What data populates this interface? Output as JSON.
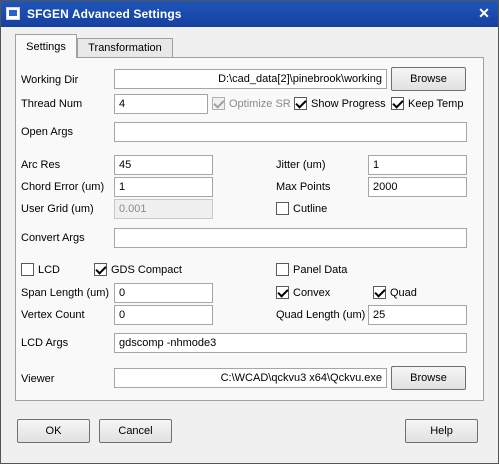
{
  "window": {
    "title": "SFGEN Advanced Settings",
    "close_glyph": "✕"
  },
  "tabs": [
    {
      "label": "Settings"
    },
    {
      "label": "Transformation"
    }
  ],
  "working_dir": {
    "label": "Working Dir",
    "value": "D:\\cad_data[2]\\pinebrook\\working",
    "browse_label": "Browse"
  },
  "thread_num": {
    "label": "Thread Num",
    "value": "4"
  },
  "optimize_sr": {
    "label": "Optimize SR",
    "checked": true,
    "enabled": false
  },
  "show_progress": {
    "label": "Show Progress",
    "checked": true
  },
  "keep_temp": {
    "label": "Keep Temp",
    "checked": true
  },
  "open_args": {
    "label": "Open Args",
    "value": ""
  },
  "arc_res": {
    "label": "Arc Res",
    "value": "45"
  },
  "jitter": {
    "label": "Jitter (um)",
    "value": "1"
  },
  "chord_error": {
    "label": "Chord Error (um)",
    "value": "1"
  },
  "max_points": {
    "label": "Max Points",
    "value": "2000"
  },
  "user_grid": {
    "label": "User Grid (um)",
    "value": "0.001",
    "enabled": false
  },
  "cutline": {
    "label": "Cutline",
    "checked": false
  },
  "convert_args": {
    "label": "Convert Args",
    "value": ""
  },
  "lcd": {
    "label": "LCD",
    "checked": false
  },
  "gds_compact": {
    "label": "GDS Compact",
    "checked": true
  },
  "panel_data": {
    "label": "Panel Data",
    "checked": false
  },
  "span_length": {
    "label": "Span Length (um)",
    "value": "0"
  },
  "convex": {
    "label": "Convex",
    "checked": true
  },
  "quad": {
    "label": "Quad",
    "checked": true
  },
  "vertex_count": {
    "label": "Vertex Count",
    "value": "0"
  },
  "quad_length": {
    "label": "Quad Length (um)",
    "value": "25"
  },
  "lcd_args": {
    "label": "LCD Args",
    "value": "gdscomp -nhmode3"
  },
  "viewer": {
    "label": "Viewer",
    "value": "C:\\WCAD\\qckvu3 x64\\Qckvu.exe",
    "browse_label": "Browse"
  },
  "buttons": {
    "ok": "OK",
    "cancel": "Cancel",
    "help": "Help"
  }
}
